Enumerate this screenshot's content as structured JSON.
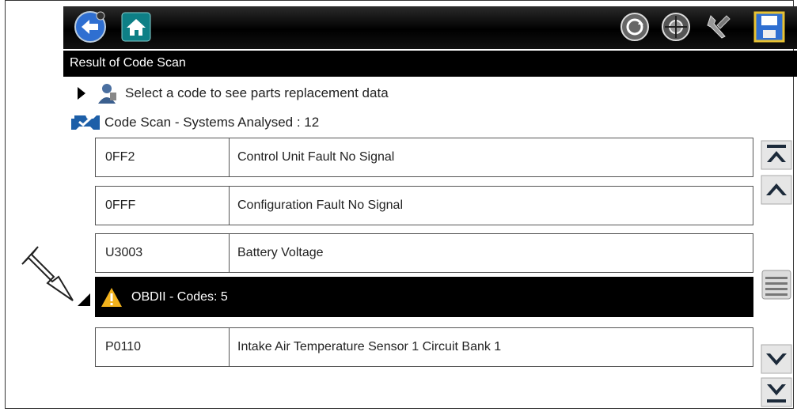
{
  "colors": {
    "toolbar_bg": "#000000",
    "button_blue": "#2f6fd1",
    "warning_yellow": "#f2b21d",
    "row_border": "#555555"
  },
  "toolbar": {
    "icons": [
      "back-icon",
      "home-icon",
      "scan-refresh-icon",
      "vehicle-icon",
      "tools-icon",
      "save-icon"
    ]
  },
  "header": {
    "title": "Result of Code Scan"
  },
  "hint": {
    "text": "Select a code to see parts replacement data"
  },
  "summary": {
    "text": "Code Scan - Systems Analysed : 12"
  },
  "codes_top": [
    {
      "code": "0FF2",
      "description": "Control Unit Fault No Signal"
    },
    {
      "code": "0FFF",
      "description": "Configuration Fault No Signal"
    },
    {
      "code": "U3003",
      "description": "Battery Voltage"
    }
  ],
  "group": {
    "label": "OBDII - Codes: 5"
  },
  "codes_bottom": [
    {
      "code": "P0110",
      "description": "Intake Air Temperature Sensor 1 Circuit Bank 1"
    }
  ],
  "scrollbar": {
    "icons": [
      "scroll-top-icon",
      "scroll-up-icon",
      "scroll-menu-icon",
      "scroll-down-icon",
      "scroll-bottom-icon"
    ]
  }
}
